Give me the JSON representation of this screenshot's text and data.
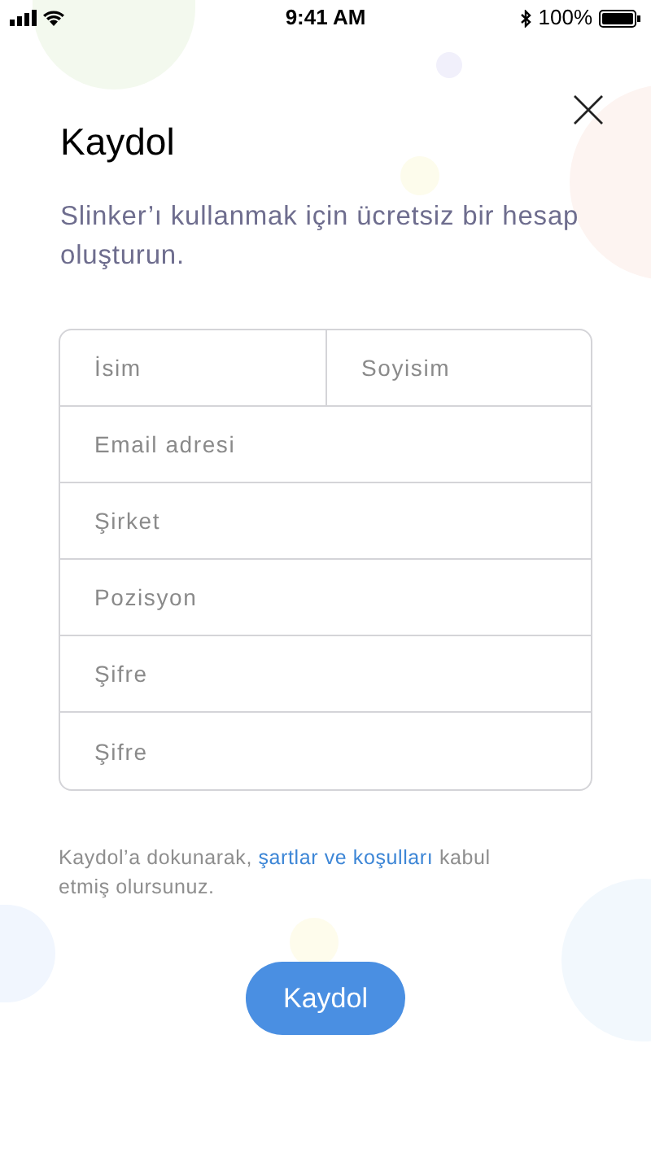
{
  "status_bar": {
    "time": "9:41 AM",
    "battery": "100%"
  },
  "title": "Kaydol",
  "subtitle": "Slinker’ı kullanmak için ücretsiz bir hesap oluşturun.",
  "form": {
    "name_row": [
      {
        "placeholder": "İsim"
      },
      {
        "placeholder": "Soyisim"
      }
    ],
    "fields": [
      {
        "placeholder": "Email adresi"
      },
      {
        "placeholder": "Şirket"
      },
      {
        "placeholder": "Pozisyon"
      },
      {
        "placeholder": "Şifre"
      },
      {
        "placeholder": "Şifre"
      }
    ]
  },
  "terms": {
    "before": "Kaydol’a dokunarak, ",
    "link": "şartlar ve koşulları",
    "after": " kabul etmiş olursunuz."
  },
  "submit": "Kaydol"
}
